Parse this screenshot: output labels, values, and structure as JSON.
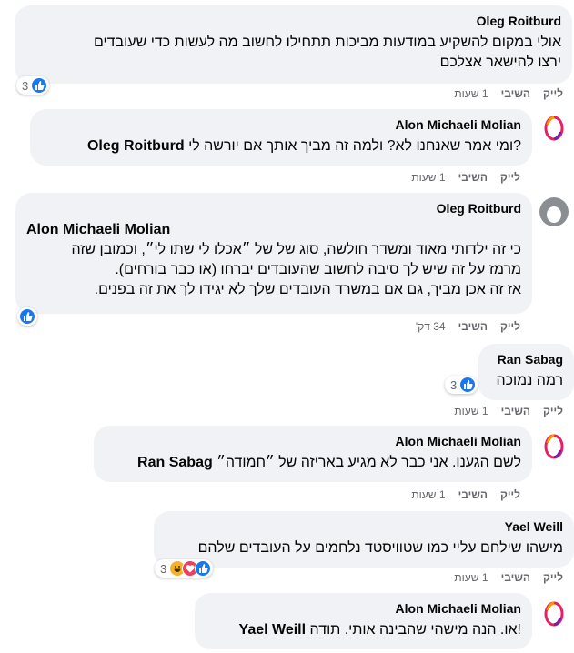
{
  "actions": {
    "like": "לייק",
    "reply": "השיבי"
  },
  "comments": [
    {
      "author": "Oleg Roitburd",
      "lines": [
        "אולי במקום להשקיע במודעות מביכות תתחילו לחשוב מה לעשות כדי שעובדים",
        "ירצו להישאר אצלכם"
      ],
      "time": "1 שעות",
      "reaction_count": "3"
    },
    {
      "author": "Alon Michaeli Molian",
      "mention": "Oleg Roitburd",
      "line_after_mention": "?ומי אמר שאנחנו לא? ולמה זה מביך אותך אם יורשה לי",
      "time": "1 שעות"
    },
    {
      "author": "Oleg Roitburd",
      "mention": "Alon Michaeli Molian",
      "lines": [
        "כי זה ילדותי מאוד ומשדר חולשה, סוג של של ״אכלו לי שתו לי״, וכמובן שזה",
        "מרמז על זה שיש לך סיבה לחשוב שהעובדים יברחו (או כבר בורחים).",
        "אז זה אכן מביך, גם אם במשרד העובדים שלך לא יגידו לך את זה בפנים."
      ],
      "time": "34 דק'"
    },
    {
      "author": "Ran Sabag",
      "lines": [
        "רמה נמוכה"
      ],
      "time": "1 שעות",
      "reaction_count": "3"
    },
    {
      "author": "Alon Michaeli Molian",
      "mention": "Ran Sabag",
      "line_after_mention": "לשם הגענו. אני כבר לא מגיע באריזה של ״חמודה״",
      "time": "1 שעות"
    },
    {
      "author": "Yael Weill",
      "lines": [
        "מישהו שילחם עליי כמו שטוויסטד נלחמים על העובדים שלהם"
      ],
      "time": "1 שעות",
      "reaction_count": "3"
    },
    {
      "author": "Alon Michaeli Molian",
      "mention": "Yael Weill",
      "line_after_mention": "!או. הנה מישהי שהבינה אותי. תודה"
    }
  ],
  "icons": {
    "like": "like-icon",
    "love": "love-icon",
    "haha": "haha-icon"
  }
}
